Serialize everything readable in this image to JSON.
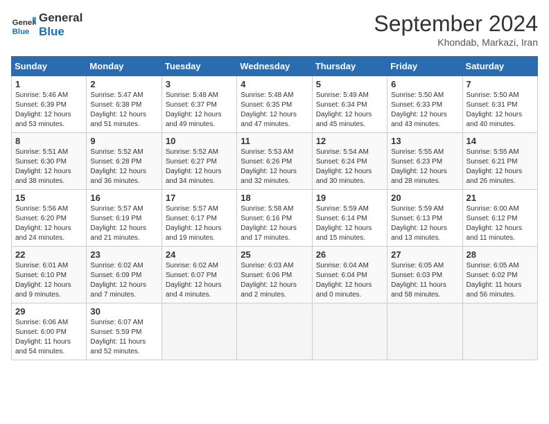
{
  "header": {
    "logo_line1": "General",
    "logo_line2": "Blue",
    "month": "September 2024",
    "location": "Khondab, Markazi, Iran"
  },
  "weekdays": [
    "Sunday",
    "Monday",
    "Tuesday",
    "Wednesday",
    "Thursday",
    "Friday",
    "Saturday"
  ],
  "weeks": [
    [
      {
        "day": "1",
        "info": "Sunrise: 5:46 AM\nSunset: 6:39 PM\nDaylight: 12 hours\nand 53 minutes."
      },
      {
        "day": "2",
        "info": "Sunrise: 5:47 AM\nSunset: 6:38 PM\nDaylight: 12 hours\nand 51 minutes."
      },
      {
        "day": "3",
        "info": "Sunrise: 5:48 AM\nSunset: 6:37 PM\nDaylight: 12 hours\nand 49 minutes."
      },
      {
        "day": "4",
        "info": "Sunrise: 5:48 AM\nSunset: 6:35 PM\nDaylight: 12 hours\nand 47 minutes."
      },
      {
        "day": "5",
        "info": "Sunrise: 5:49 AM\nSunset: 6:34 PM\nDaylight: 12 hours\nand 45 minutes."
      },
      {
        "day": "6",
        "info": "Sunrise: 5:50 AM\nSunset: 6:33 PM\nDaylight: 12 hours\nand 43 minutes."
      },
      {
        "day": "7",
        "info": "Sunrise: 5:50 AM\nSunset: 6:31 PM\nDaylight: 12 hours\nand 40 minutes."
      }
    ],
    [
      {
        "day": "8",
        "info": "Sunrise: 5:51 AM\nSunset: 6:30 PM\nDaylight: 12 hours\nand 38 minutes."
      },
      {
        "day": "9",
        "info": "Sunrise: 5:52 AM\nSunset: 6:28 PM\nDaylight: 12 hours\nand 36 minutes."
      },
      {
        "day": "10",
        "info": "Sunrise: 5:52 AM\nSunset: 6:27 PM\nDaylight: 12 hours\nand 34 minutes."
      },
      {
        "day": "11",
        "info": "Sunrise: 5:53 AM\nSunset: 6:26 PM\nDaylight: 12 hours\nand 32 minutes."
      },
      {
        "day": "12",
        "info": "Sunrise: 5:54 AM\nSunset: 6:24 PM\nDaylight: 12 hours\nand 30 minutes."
      },
      {
        "day": "13",
        "info": "Sunrise: 5:55 AM\nSunset: 6:23 PM\nDaylight: 12 hours\nand 28 minutes."
      },
      {
        "day": "14",
        "info": "Sunrise: 5:55 AM\nSunset: 6:21 PM\nDaylight: 12 hours\nand 26 minutes."
      }
    ],
    [
      {
        "day": "15",
        "info": "Sunrise: 5:56 AM\nSunset: 6:20 PM\nDaylight: 12 hours\nand 24 minutes."
      },
      {
        "day": "16",
        "info": "Sunrise: 5:57 AM\nSunset: 6:19 PM\nDaylight: 12 hours\nand 21 minutes."
      },
      {
        "day": "17",
        "info": "Sunrise: 5:57 AM\nSunset: 6:17 PM\nDaylight: 12 hours\nand 19 minutes."
      },
      {
        "day": "18",
        "info": "Sunrise: 5:58 AM\nSunset: 6:16 PM\nDaylight: 12 hours\nand 17 minutes."
      },
      {
        "day": "19",
        "info": "Sunrise: 5:59 AM\nSunset: 6:14 PM\nDaylight: 12 hours\nand 15 minutes."
      },
      {
        "day": "20",
        "info": "Sunrise: 5:59 AM\nSunset: 6:13 PM\nDaylight: 12 hours\nand 13 minutes."
      },
      {
        "day": "21",
        "info": "Sunrise: 6:00 AM\nSunset: 6:12 PM\nDaylight: 12 hours\nand 11 minutes."
      }
    ],
    [
      {
        "day": "22",
        "info": "Sunrise: 6:01 AM\nSunset: 6:10 PM\nDaylight: 12 hours\nand 9 minutes."
      },
      {
        "day": "23",
        "info": "Sunrise: 6:02 AM\nSunset: 6:09 PM\nDaylight: 12 hours\nand 7 minutes."
      },
      {
        "day": "24",
        "info": "Sunrise: 6:02 AM\nSunset: 6:07 PM\nDaylight: 12 hours\nand 4 minutes."
      },
      {
        "day": "25",
        "info": "Sunrise: 6:03 AM\nSunset: 6:06 PM\nDaylight: 12 hours\nand 2 minutes."
      },
      {
        "day": "26",
        "info": "Sunrise: 6:04 AM\nSunset: 6:04 PM\nDaylight: 12 hours\nand 0 minutes."
      },
      {
        "day": "27",
        "info": "Sunrise: 6:05 AM\nSunset: 6:03 PM\nDaylight: 11 hours\nand 58 minutes."
      },
      {
        "day": "28",
        "info": "Sunrise: 6:05 AM\nSunset: 6:02 PM\nDaylight: 11 hours\nand 56 minutes."
      }
    ],
    [
      {
        "day": "29",
        "info": "Sunrise: 6:06 AM\nSunset: 6:00 PM\nDaylight: 11 hours\nand 54 minutes."
      },
      {
        "day": "30",
        "info": "Sunrise: 6:07 AM\nSunset: 5:59 PM\nDaylight: 11 hours\nand 52 minutes."
      },
      {
        "day": "",
        "info": ""
      },
      {
        "day": "",
        "info": ""
      },
      {
        "day": "",
        "info": ""
      },
      {
        "day": "",
        "info": ""
      },
      {
        "day": "",
        "info": ""
      }
    ]
  ]
}
